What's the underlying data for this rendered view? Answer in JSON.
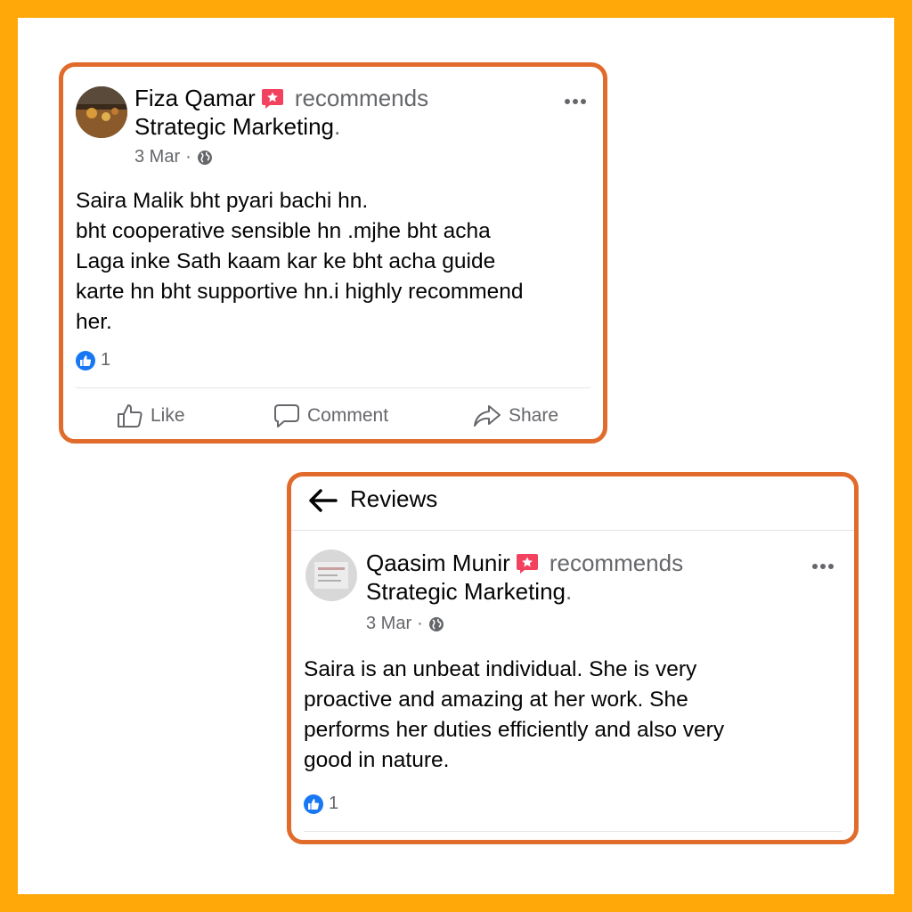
{
  "colors": {
    "frame": "#FFA809",
    "card_border": "#E06B2B",
    "secondary_text": "#65676B",
    "like_blue": "#1877F2",
    "badge_pink": "#F3425F"
  },
  "review1": {
    "author": "Fiza Qamar",
    "verb": "recommends",
    "page": "Strategic Marketing",
    "page_suffix": ".",
    "date": "3 Mar",
    "separator": "·",
    "audience_icon": "globe-icon",
    "lines": [
      "Saira Malik bht pyari bachi hn.",
      "bht cooperative sensible hn .mjhe bht acha",
      "Laga inke Sath kaam kar ke bht acha guide",
      "karte hn bht supportive hn.i highly recommend",
      "her."
    ],
    "like_count": "1",
    "actions": {
      "like": "Like",
      "comment": "Comment",
      "share": "Share"
    }
  },
  "review2": {
    "header_title": "Reviews",
    "author": "Qaasim Munir",
    "verb": "recommends",
    "page": "Strategic Marketing",
    "page_suffix": ".",
    "date": "3 Mar",
    "separator": "·",
    "audience_icon": "globe-icon",
    "lines": [
      "Saira is an unbeat individual. She is very",
      "proactive and amazing at her work. She",
      "performs her duties efficiently and also very",
      "good in nature."
    ],
    "like_count": "1"
  }
}
